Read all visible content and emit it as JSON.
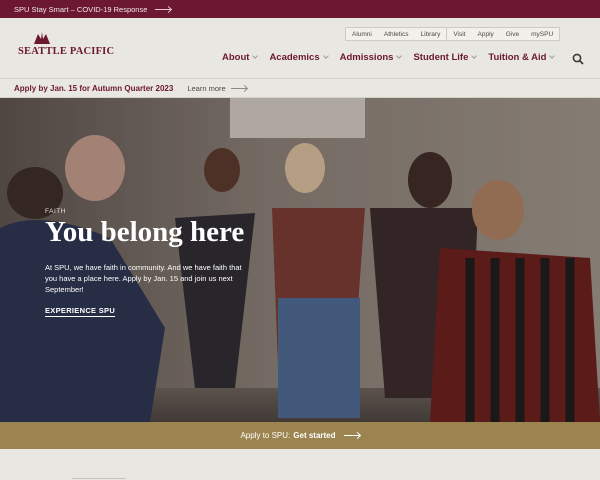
{
  "alert": {
    "text": "SPU Stay Smart – COVID-19 Response"
  },
  "brand": {
    "name": "SEATTLE PACIFIC"
  },
  "utility_nav": {
    "group1": [
      "Alumni",
      "Athletics",
      "Library"
    ],
    "group2": [
      "Visit",
      "Apply",
      "Give",
      "mySPU"
    ]
  },
  "main_nav": [
    "About",
    "Academics",
    "Admissions",
    "Student Life",
    "Tuition & Aid"
  ],
  "icons": {
    "search": "search-icon",
    "logo": "flame-logo-icon",
    "arrow": "arrow-right-icon"
  },
  "apply_bar": {
    "deadline": "Apply by Jan. 15 for Autumn Quarter 2023",
    "learn_more": "Learn more"
  },
  "hero": {
    "eyebrow": "FAITH",
    "title": "You belong here",
    "blurb": "At SPU, we have faith in community. And we have faith that you have a place here. Apply by Jan. 15 and join us next September!",
    "cta": "EXPERIENCE SPU"
  },
  "gold_bar": {
    "lead": "Apply to SPU:",
    "action": "Get started"
  },
  "colors": {
    "maroon": "#6b1830",
    "gold": "#9b8450",
    "cream": "#e9e7e1"
  }
}
